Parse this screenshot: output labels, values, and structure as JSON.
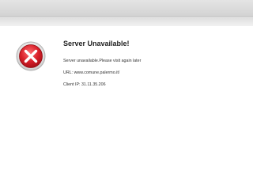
{
  "page": {
    "title": "Server Unavailable!",
    "message": "Server unavailable.Please visit again later",
    "url_label": "URL:",
    "url_value": "www.comune.palermo.it/",
    "client_ip_label": "Client IP:",
    "client_ip_value": "31.11.35.206"
  },
  "icons": {
    "status": "error-x-icon"
  },
  "colors": {
    "icon_red": "#d8202a",
    "icon_ring": "#cfcfcf",
    "header_gray": "#d8d8d8"
  }
}
